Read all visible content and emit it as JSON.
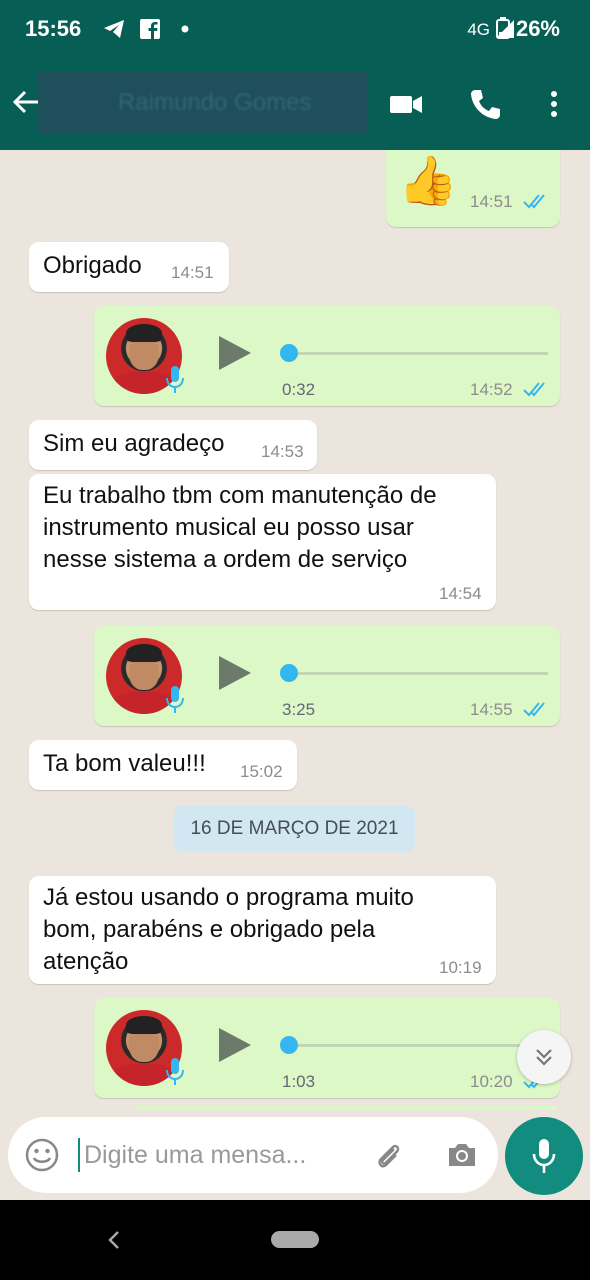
{
  "status_bar": {
    "time": "15:56",
    "network": "4G",
    "battery": "26%"
  },
  "header": {
    "contact_name": "Raimundo Gomes"
  },
  "messages": {
    "m1": {
      "emoji": "👍",
      "time": "14:51"
    },
    "m2": {
      "text": "Obrigado",
      "time": "14:51"
    },
    "m3": {
      "duration": "0:32",
      "time": "14:52",
      "progress": 0
    },
    "m4": {
      "text": "Sim eu agradeço",
      "time": "14:53"
    },
    "m5": {
      "line1": "Eu trabalho tbm com manutenção de",
      "line2": "instrumento musical eu posso usar",
      "line3": "nesse sistema a ordem de serviço",
      "time": "14:54"
    },
    "m6": {
      "duration": "3:25",
      "time": "14:55",
      "progress": 0
    },
    "m7": {
      "text": "Ta bom valeu!!!",
      "time": "15:02"
    },
    "date_divider": "16 DE MARÇO DE 2021",
    "m8": {
      "line1": "Já estou usando o programa muito",
      "line2": "bom, parabéns e obrigado pela",
      "line3": "atenção",
      "time": "10:19"
    },
    "m9": {
      "duration": "1:03",
      "time": "10:20",
      "progress": 0
    }
  },
  "composer": {
    "placeholder": "Digite uma mensa..."
  },
  "colors": {
    "header": "#075e54",
    "outgoing": "#dcf8c6",
    "incoming": "#ffffff",
    "read_ticks": "#34b7f1",
    "fab": "#128c7e"
  }
}
